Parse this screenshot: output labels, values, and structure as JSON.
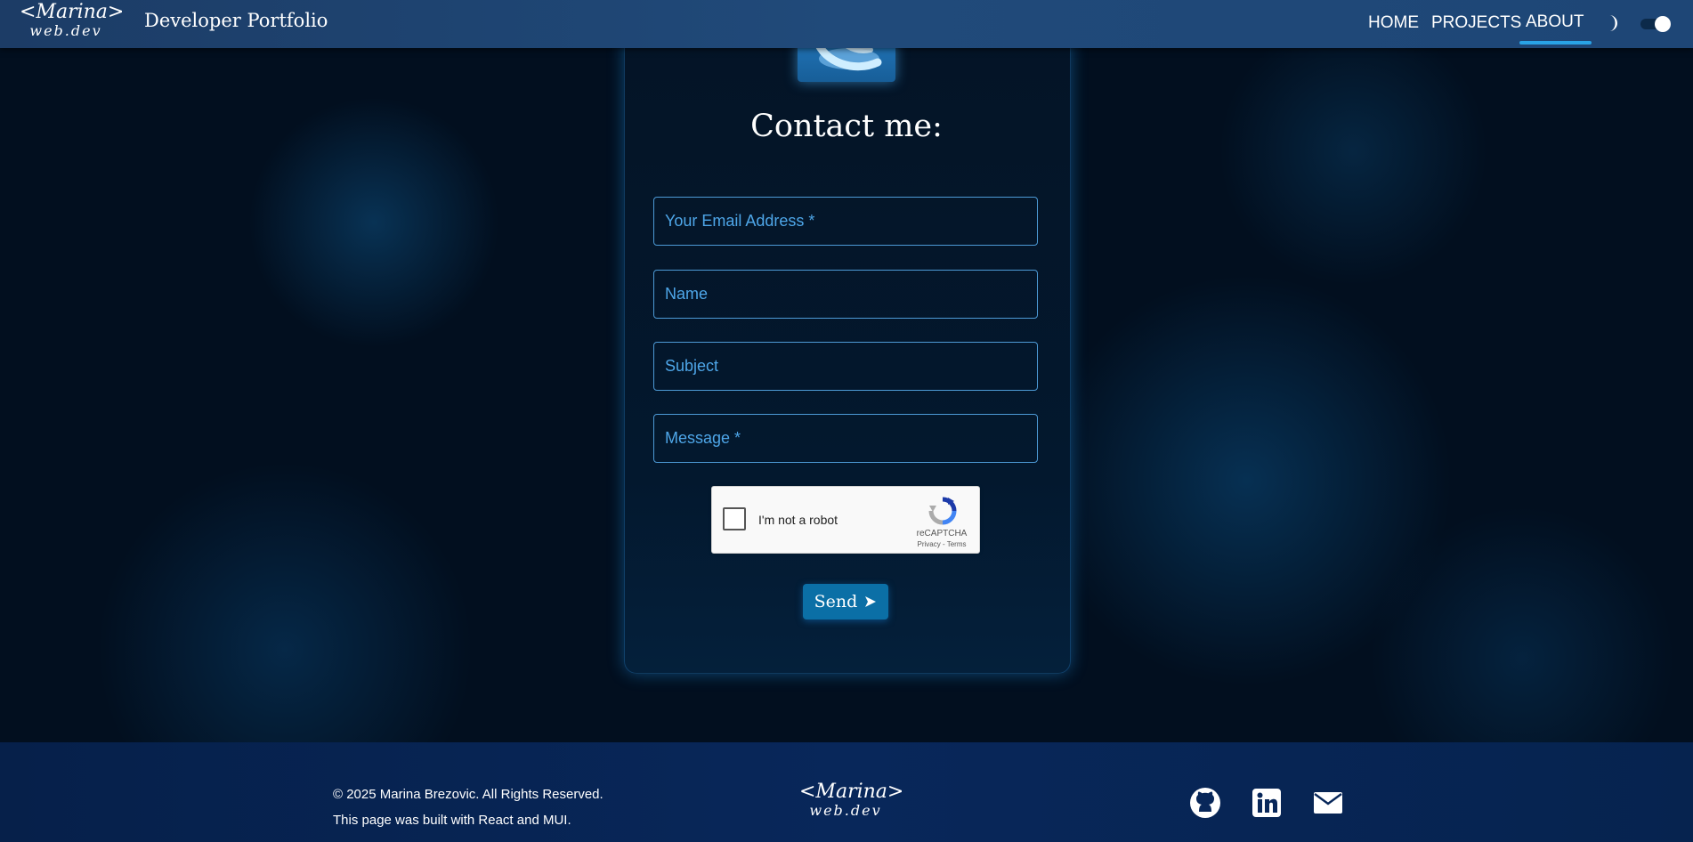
{
  "nav": {
    "logo_line1": "<Marina>",
    "logo_line2": "web.dev",
    "site_title": "Developer Portfolio",
    "links": [
      "HOME",
      "PROJECTS",
      "ABOUT"
    ],
    "active_link": "ABOUT",
    "theme_icon": "moon-icon",
    "theme_toggle_on": true
  },
  "contact": {
    "title": "Contact me:",
    "fields": {
      "email_placeholder": "Your Email Address *",
      "name_placeholder": "Name",
      "subject_placeholder": "Subject",
      "message_placeholder": "Message *"
    },
    "recaptcha": {
      "label": "I'm not a robot",
      "brand": "reCAPTCHA",
      "links": "Privacy - Terms"
    },
    "send_label": "Send"
  },
  "footer": {
    "copyright": "© 2025 Marina Brezovic. All Rights Reserved.",
    "built_with": "This page was built with React and MUI.",
    "logo_line1": "<Marina>",
    "logo_line2": "web.dev",
    "social_icons": [
      "github-icon",
      "linkedin-icon",
      "mail-icon"
    ]
  },
  "colors": {
    "accent": "#29a3e6",
    "field_border": "#4d9ad6",
    "placeholder": "#4ea6e8",
    "send_button": "#0b6fa6",
    "nav_bg": "#204a7a",
    "footer_bg": "#08275a"
  }
}
